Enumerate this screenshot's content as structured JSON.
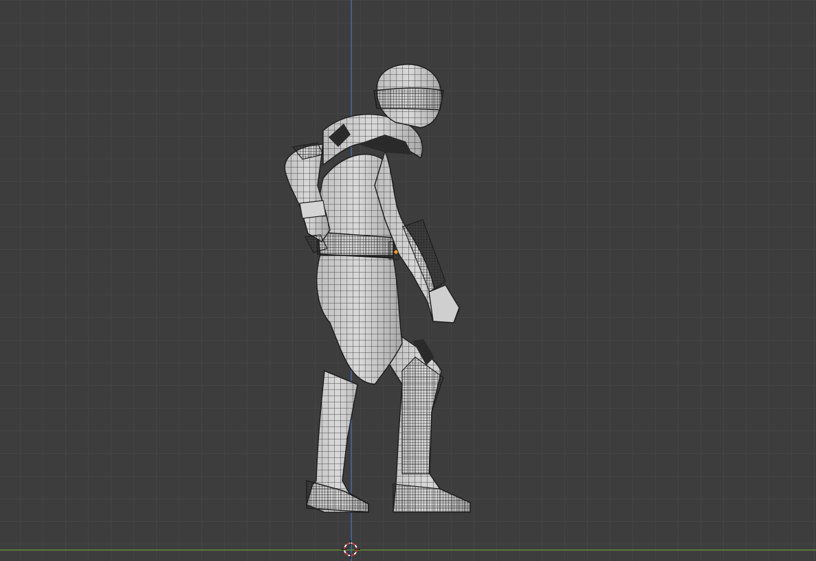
{
  "viewport": {
    "view": "right-orthographic",
    "shading": "solid-with-wireframe-overlay",
    "colors": {
      "background": "#3d3d3d",
      "grid_minor": "#4a4a4a",
      "grid_major": "#535353",
      "axis_z": "#4b78c7",
      "axis_y": "#6d9a3a",
      "mesh_fill": "#c9c9c9",
      "mesh_wire": "#1e1e1e",
      "cursor_red": "#e03a3a",
      "origin_dot": "#ff9d2a"
    },
    "icons": {
      "cursor": "3d-cursor-icon",
      "origin": "object-origin-icon"
    },
    "object": "character-mesh"
  }
}
